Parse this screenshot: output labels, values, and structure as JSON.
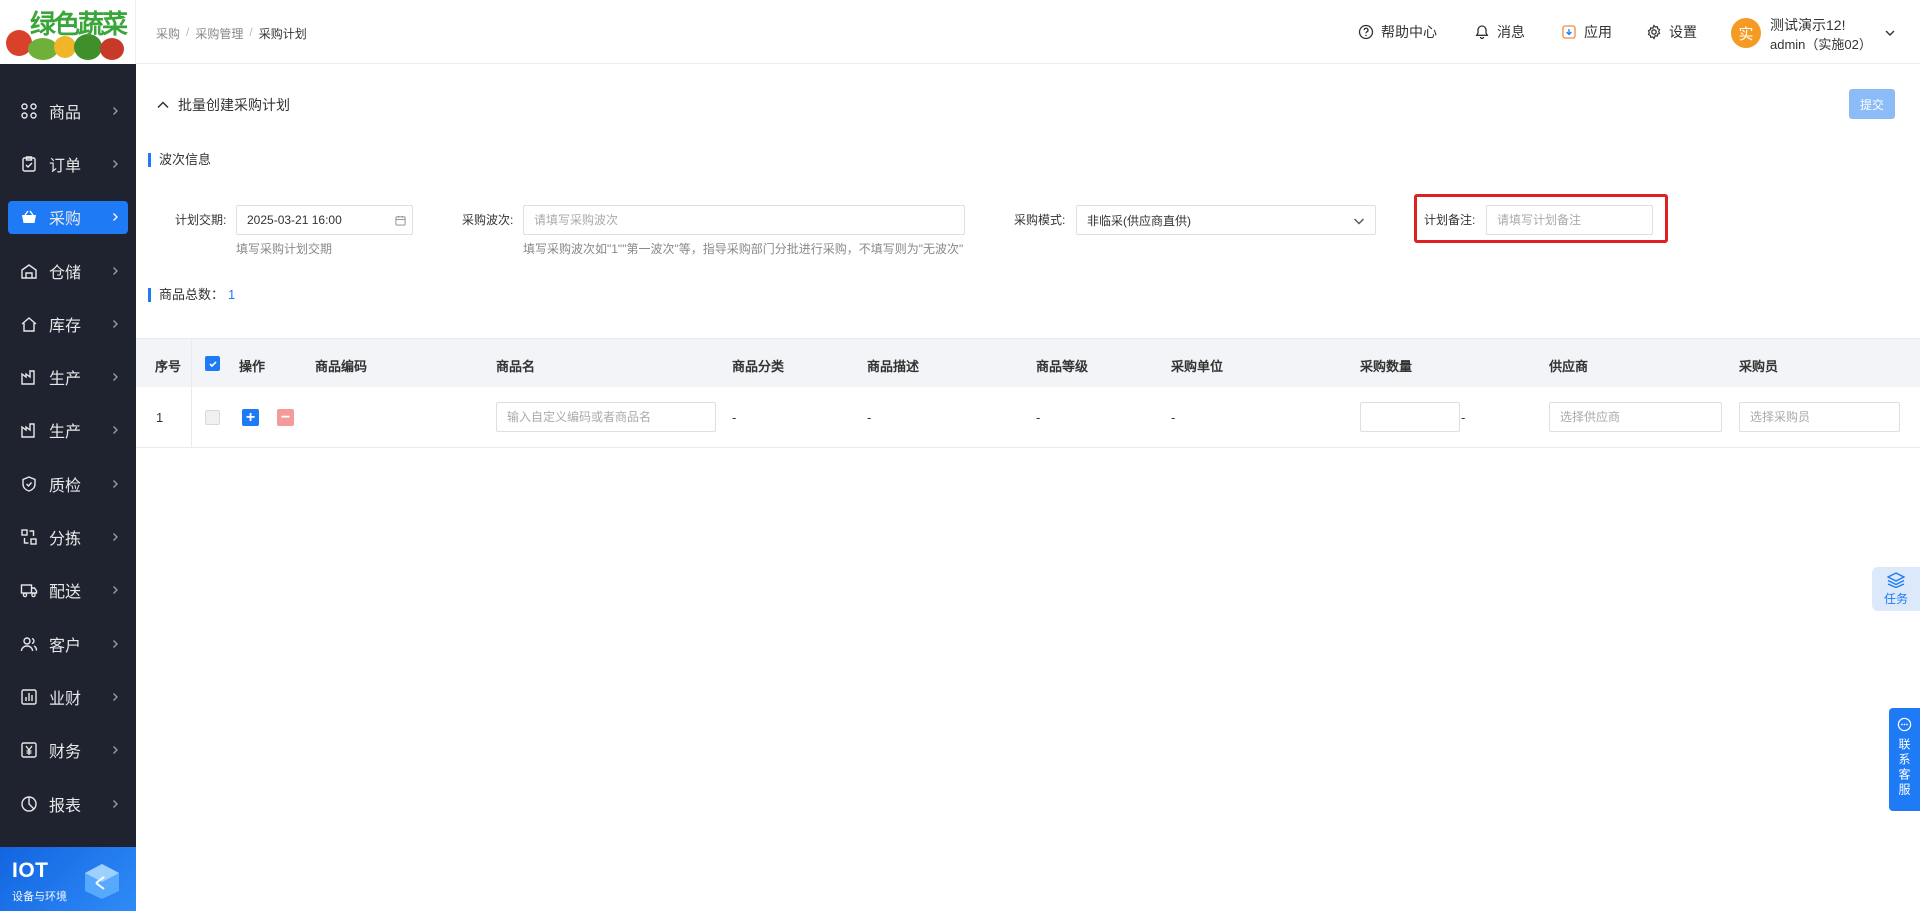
{
  "app": {
    "logo_text": "绿色蔬菜"
  },
  "sidebar": {
    "items": [
      {
        "label": "商品",
        "icon": "grid-icon"
      },
      {
        "label": "订单",
        "icon": "clipboard-icon"
      },
      {
        "label": "采购",
        "icon": "basket-icon",
        "active": true
      },
      {
        "label": "仓储",
        "icon": "warehouse-icon"
      },
      {
        "label": "库存",
        "icon": "home-icon"
      },
      {
        "label": "生产",
        "icon": "factory-icon"
      },
      {
        "label": "生产",
        "icon": "factory-icon"
      },
      {
        "label": "质检",
        "icon": "shield-icon"
      },
      {
        "label": "分拣",
        "icon": "sort-icon"
      },
      {
        "label": "配送",
        "icon": "truck-icon"
      },
      {
        "label": "客户",
        "icon": "users-icon"
      },
      {
        "label": "业财",
        "icon": "bar-chart-icon"
      },
      {
        "label": "财务",
        "icon": "yuan-icon"
      },
      {
        "label": "报表",
        "icon": "pie-chart-icon"
      }
    ],
    "iot": {
      "title": "IOT",
      "subtitle": "设备与环境"
    }
  },
  "header": {
    "breadcrumb": [
      "采购",
      "采购管理",
      "采购计划"
    ],
    "help": "帮助中心",
    "messages": "消息",
    "apps": "应用",
    "settings": "设置",
    "avatar_char": "实",
    "user_name": "测试演示12!",
    "user_sub": "admin（实施02）"
  },
  "page": {
    "title": "批量创建采购计划",
    "submit": "提交",
    "batch_section": "波次信息",
    "fields": {
      "delivery_label": "计划交期:",
      "delivery_value": "2025-03-21 16:00",
      "delivery_hint": "填写采购计划交期",
      "batch_label": "采购波次:",
      "batch_placeholder": "请填写采购波次",
      "batch_hint": "填写采购波次如\"1\"\"第一波次\"等，指导采购部门分批进行采购，不填写则为\"无波次\"",
      "mode_label": "采购模式:",
      "mode_value": "非临采(供应商直供)",
      "remark_label": "计划备注:",
      "remark_placeholder": "请填写计划备注"
    },
    "count_label": "商品总数：",
    "count_value": "1"
  },
  "table": {
    "headers": [
      "序号",
      "操作",
      "商品编码",
      "商品名",
      "商品分类",
      "商品描述",
      "商品等级",
      "采购单位",
      "采购数量",
      "供应商",
      "采购员"
    ],
    "row": {
      "index": "1",
      "name_placeholder": "输入自定义编码或者商品名",
      "category": "-",
      "desc": "-",
      "grade": "-",
      "unit": "-",
      "qty_suffix": "-",
      "supplier_placeholder": "选择供应商",
      "buyer_placeholder": "选择采购员"
    }
  },
  "widgets": {
    "task": "任务",
    "service": "联系客服"
  }
}
